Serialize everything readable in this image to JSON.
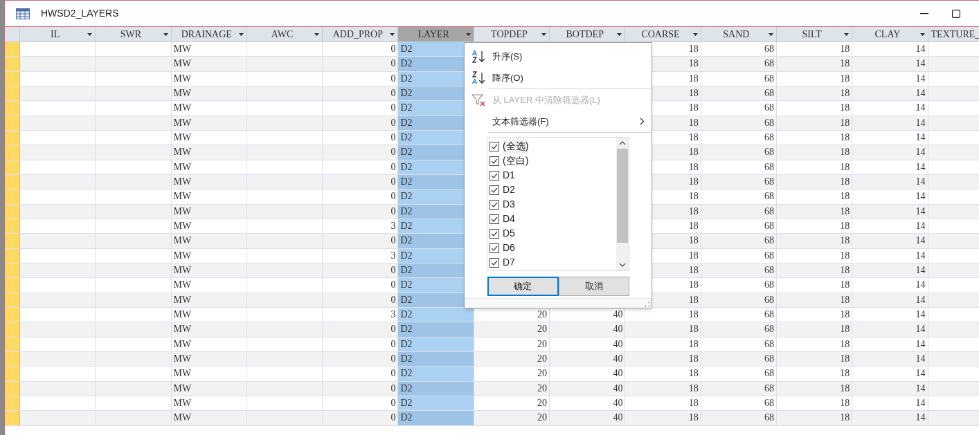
{
  "window": {
    "title": "HWSD2_LAYERS"
  },
  "table": {
    "columns": [
      {
        "label": "IL",
        "kind": "text",
        "selected": false
      },
      {
        "label": "SWR",
        "kind": "text",
        "selected": false
      },
      {
        "label": "DRAINAGE",
        "kind": "text",
        "selected": false
      },
      {
        "label": "AWC",
        "kind": "text",
        "selected": false
      },
      {
        "label": "ADD_PROP",
        "kind": "number",
        "selected": false
      },
      {
        "label": "LAYER",
        "kind": "text",
        "selected": true
      },
      {
        "label": "TOPDEP",
        "kind": "number",
        "selected": false
      },
      {
        "label": "BOTDEP",
        "kind": "number",
        "selected": false
      },
      {
        "label": "COARSE",
        "kind": "number",
        "selected": false
      },
      {
        "label": "SAND",
        "kind": "number",
        "selected": false
      },
      {
        "label": "SILT",
        "kind": "number",
        "selected": false
      },
      {
        "label": "CLAY",
        "kind": "number",
        "selected": false
      },
      {
        "label": "TEXTURE_",
        "kind": "text",
        "selected": false
      }
    ],
    "rows": [
      [
        null,
        null,
        "MW",
        null,
        "0",
        "D2",
        null,
        null,
        "18",
        "68",
        "18",
        "14",
        null
      ],
      [
        null,
        null,
        "MW",
        null,
        "0",
        "D2",
        null,
        null,
        "18",
        "68",
        "18",
        "14",
        null
      ],
      [
        null,
        null,
        "MW",
        null,
        "0",
        "D2",
        null,
        null,
        "18",
        "68",
        "18",
        "14",
        null
      ],
      [
        null,
        null,
        "MW",
        null,
        "0",
        "D2",
        null,
        null,
        "18",
        "68",
        "18",
        "14",
        null
      ],
      [
        null,
        null,
        "MW",
        null,
        "0",
        "D2",
        null,
        null,
        "18",
        "68",
        "18",
        "14",
        null
      ],
      [
        null,
        null,
        "MW",
        null,
        "0",
        "D2",
        null,
        null,
        "18",
        "68",
        "18",
        "14",
        null
      ],
      [
        null,
        null,
        "MW",
        null,
        "0",
        "D2",
        null,
        null,
        "18",
        "68",
        "18",
        "14",
        null
      ],
      [
        null,
        null,
        "MW",
        null,
        "0",
        "D2",
        null,
        null,
        "18",
        "68",
        "18",
        "14",
        null
      ],
      [
        null,
        null,
        "MW",
        null,
        "0",
        "D2",
        null,
        null,
        "18",
        "68",
        "18",
        "14",
        null
      ],
      [
        null,
        null,
        "MW",
        null,
        "0",
        "D2",
        null,
        null,
        "18",
        "68",
        "18",
        "14",
        null
      ],
      [
        null,
        null,
        "MW",
        null,
        "0",
        "D2",
        null,
        null,
        "18",
        "68",
        "18",
        "14",
        null
      ],
      [
        null,
        null,
        "MW",
        null,
        "0",
        "D2",
        null,
        null,
        "18",
        "68",
        "18",
        "14",
        null
      ],
      [
        null,
        null,
        "MW",
        null,
        "3",
        "D2",
        null,
        null,
        "18",
        "68",
        "18",
        "14",
        null
      ],
      [
        null,
        null,
        "MW",
        null,
        "0",
        "D2",
        null,
        null,
        "18",
        "68",
        "18",
        "14",
        null
      ],
      [
        null,
        null,
        "MW",
        null,
        "3",
        "D2",
        null,
        null,
        "18",
        "68",
        "18",
        "14",
        null
      ],
      [
        null,
        null,
        "MW",
        null,
        "0",
        "D2",
        null,
        null,
        "18",
        "68",
        "18",
        "14",
        null
      ],
      [
        null,
        null,
        "MW",
        null,
        "0",
        "D2",
        null,
        null,
        "18",
        "68",
        "18",
        "14",
        null
      ],
      [
        null,
        null,
        "MW",
        null,
        "0",
        "D2",
        null,
        null,
        "18",
        "68",
        "18",
        "14",
        null
      ],
      [
        null,
        null,
        "MW",
        null,
        "3",
        "D2",
        "20",
        "40",
        "18",
        "68",
        "18",
        "14",
        null
      ],
      [
        null,
        null,
        "MW",
        null,
        "0",
        "D2",
        "20",
        "40",
        "18",
        "68",
        "18",
        "14",
        null
      ],
      [
        null,
        null,
        "MW",
        null,
        "0",
        "D2",
        "20",
        "40",
        "18",
        "68",
        "18",
        "14",
        null
      ],
      [
        null,
        null,
        "MW",
        null,
        "0",
        "D2",
        "20",
        "40",
        "18",
        "68",
        "18",
        "14",
        null
      ],
      [
        null,
        null,
        "MW",
        null,
        "0",
        "D2",
        "20",
        "40",
        "18",
        "68",
        "18",
        "14",
        null
      ],
      [
        null,
        null,
        "MW",
        null,
        "0",
        "D2",
        "20",
        "40",
        "18",
        "68",
        "18",
        "14",
        null
      ],
      [
        null,
        null,
        "MW",
        null,
        "0",
        "D2",
        "20",
        "40",
        "18",
        "68",
        "18",
        "14",
        null
      ],
      [
        null,
        null,
        "MW",
        null,
        "0",
        "D2",
        "20",
        "40",
        "18",
        "68",
        "18",
        "14",
        null
      ]
    ]
  },
  "filter_menu": {
    "items": [
      {
        "kind": "sort_asc",
        "label": "升序(S)",
        "disabled": false
      },
      {
        "kind": "sort_desc",
        "label": "降序(O)",
        "disabled": false
      },
      {
        "kind": "clear",
        "label": "从 LAYER 中清除筛选器(L)",
        "disabled": true
      },
      {
        "kind": "submenu",
        "label": "文本筛选器(F)",
        "disabled": false
      }
    ],
    "values": [
      {
        "label": "(全选)",
        "checked": true
      },
      {
        "label": "(空白)",
        "checked": true
      },
      {
        "label": "D1",
        "checked": true
      },
      {
        "label": "D2",
        "checked": true
      },
      {
        "label": "D3",
        "checked": true
      },
      {
        "label": "D4",
        "checked": true
      },
      {
        "label": "D5",
        "checked": true
      },
      {
        "label": "D6",
        "checked": true
      },
      {
        "label": "D7",
        "checked": true
      }
    ],
    "buttons": [
      {
        "label": "确定",
        "selected": true
      },
      {
        "label": "取消",
        "selected": false
      }
    ]
  }
}
